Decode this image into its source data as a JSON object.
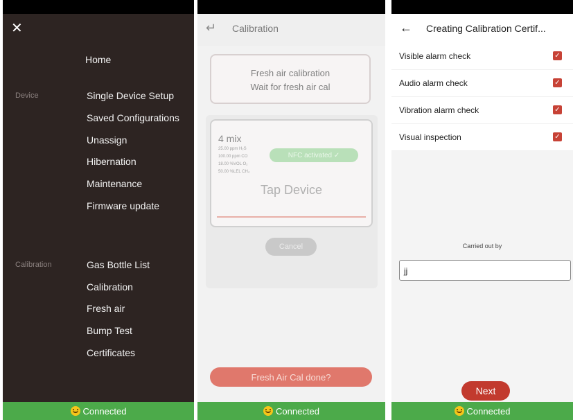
{
  "status": {
    "connected_label": "Connected"
  },
  "menu_panel": {
    "home": "Home",
    "sections": [
      {
        "label": "Device",
        "items": [
          "Single Device Setup",
          "Saved Configurations",
          "Unassign",
          "Hibernation",
          "Maintenance",
          "Firmware update"
        ]
      },
      {
        "label": "Calibration",
        "items": [
          "Gas Bottle List",
          "Calibration",
          "Fresh air",
          "Bump Test",
          "Certificates"
        ]
      }
    ]
  },
  "calibration_panel": {
    "title": "Calibration",
    "fresh_air_line1": "Fresh air calibration",
    "fresh_air_line2": "Wait for fresh air cal",
    "mix_title": "4 mix",
    "gas_lines": [
      "25.00 ppm H₂S",
      "100.00 ppm CO",
      "18.00 %VOL O₂",
      "50.00 %LEL CH₄"
    ],
    "nfc_label": "NFC activated ✓",
    "tap_label": "Tap Device",
    "cancel_label": "Cancel",
    "fresh_done_label": "Fresh Air Cal done?"
  },
  "certificate_panel": {
    "title": "Creating Calibration Certif...",
    "checks": [
      {
        "label": "Visible alarm check",
        "checked": true
      },
      {
        "label": "Audio alarm check",
        "checked": true
      },
      {
        "label": "Vibration alarm check",
        "checked": true
      },
      {
        "label": "Visual inspection",
        "checked": true
      }
    ],
    "carried_out_label": "Carried out by",
    "carried_out_value": "jj",
    "next_label": "Next"
  }
}
